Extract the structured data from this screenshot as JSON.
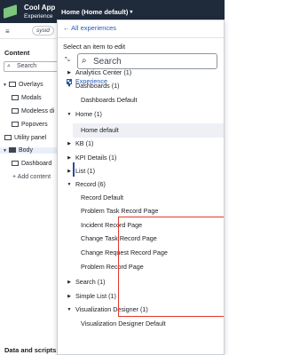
{
  "header": {
    "app_name": "Cool App",
    "app_subtitle": "Experience",
    "page_selector": "Home (Home default)",
    "caret": "▾"
  },
  "left_panel": {
    "menu_icon": "≡",
    "sysid": "sysid",
    "content_title": "Content",
    "search_placeholder": "Search",
    "tree": [
      {
        "label": "Overlays",
        "expanded": true
      },
      {
        "label": "Modals"
      },
      {
        "label": "Modeless di"
      },
      {
        "label": "Popovers"
      },
      {
        "label": "Utility panel"
      },
      {
        "label": "Body",
        "expanded": true
      },
      {
        "label": "Dashboard"
      },
      {
        "label": "Add content"
      }
    ],
    "data_scripts": "Data and scripts"
  },
  "dropdown": {
    "back_link": "All experiences",
    "select_label": "Select an item to edit",
    "search_placeholder": "Search",
    "experience_label": "Experience",
    "items": [
      {
        "label": "Analytics Center (1)",
        "level": 1,
        "expanded": false
      },
      {
        "label": "Dashboards (1)",
        "level": 1,
        "expanded": true
      },
      {
        "label": "Dashboards Default",
        "level": 2
      },
      {
        "label": "Home (1)",
        "level": 1,
        "expanded": true
      },
      {
        "label": "Home default",
        "level": 2,
        "selected": true
      },
      {
        "label": "KB (1)",
        "level": 1,
        "expanded": false
      },
      {
        "label": "KPI Details (1)",
        "level": 1,
        "expanded": false
      },
      {
        "label": "List (1)",
        "level": 1,
        "expanded": false
      },
      {
        "label": "Record (6)",
        "level": 1,
        "expanded": true
      },
      {
        "label": "Record Default",
        "level": 2
      },
      {
        "label": "Problem Task Record Page",
        "level": 2
      },
      {
        "label": "Incident Record Page",
        "level": 2
      },
      {
        "label": "Change Task Record Page",
        "level": 2
      },
      {
        "label": "Change Request Record Page",
        "level": 2
      },
      {
        "label": "Problem Record Page",
        "level": 2
      },
      {
        "label": "Search (1)",
        "level": 1,
        "expanded": false
      },
      {
        "label": "Simple List (1)",
        "level": 1,
        "expanded": false
      },
      {
        "label": "Visualization Designer (1)",
        "level": 1,
        "expanded": true
      },
      {
        "label": "Visualization Designer Default",
        "level": 2
      }
    ]
  },
  "colors": {
    "header_bg": "#1f2b3a",
    "link_blue": "#2459b6",
    "highlight_red": "#e23a2a",
    "logo_green": "#7ec67e"
  }
}
